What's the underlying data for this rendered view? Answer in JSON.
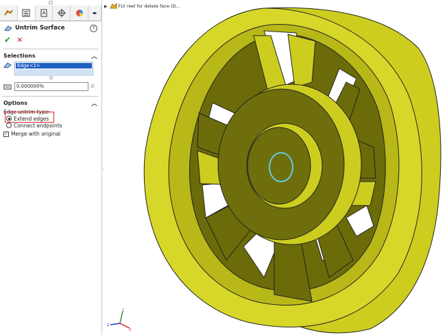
{
  "panel": {
    "tabs": [
      "feature-manager-icon",
      "property-manager-icon",
      "configuration-manager-icon",
      "dimxpert-icon",
      "display-manager-icon",
      "more-tabs-icon"
    ],
    "title": "Untrim Surface",
    "help": "?",
    "ok_symbol": "✔",
    "cancel_symbol": "✕",
    "selections": {
      "header": "Selections",
      "items": [
        "Edge<1>"
      ]
    },
    "distance": {
      "value": "0.000000%"
    },
    "options": {
      "header": "Options",
      "edge_untrim_label": "Edge untrim type:",
      "radio_extend": "Extend edges",
      "radio_connect": "Connect endpoints",
      "selected": "Extend edges",
      "merge_label": "Merge with original",
      "merge_checked": true
    }
  },
  "tree": {
    "part_name": "FLY reel for delete face (D..."
  },
  "triad": {
    "x": "X",
    "y": "Y",
    "z": "Z"
  },
  "colors": {
    "part_yellow": "#cdcd1f",
    "part_shadow": "#6e6e0c",
    "selection_blue": "#1f5fc0",
    "highlight_red": "#d6262c",
    "ok_green": "#1f9d2e"
  }
}
